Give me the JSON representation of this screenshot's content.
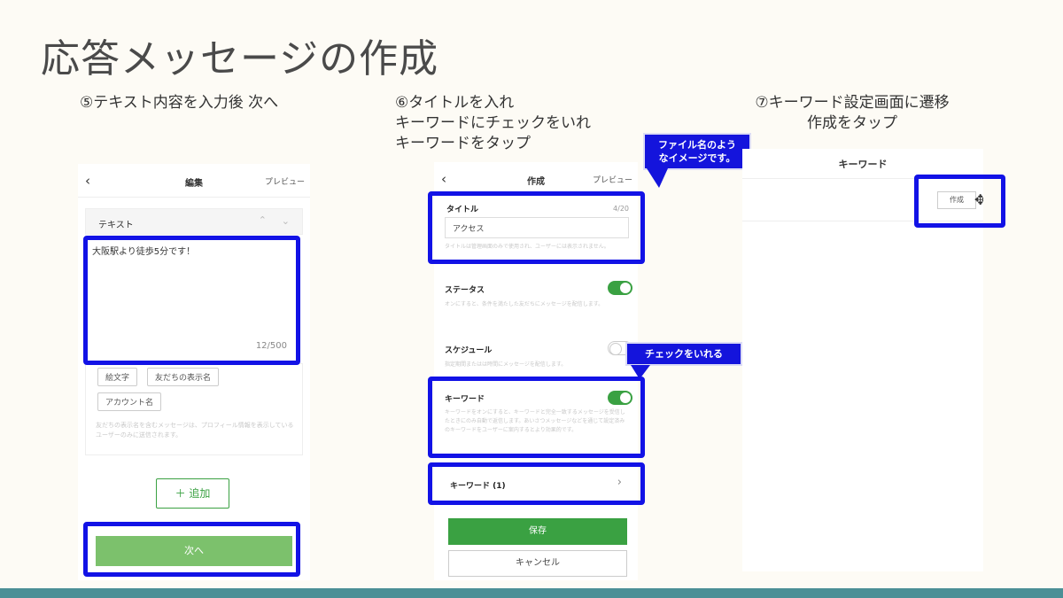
{
  "slide_title": "応答メッセージの作成",
  "steps": [
    {
      "caption_lines": [
        "⑤テキスト内容を入力後 次へ"
      ]
    },
    {
      "caption_lines": [
        "⑥タイトルを入れ",
        "キーワードにチェックをいれ",
        "キーワードをタップ"
      ]
    },
    {
      "caption_lines": [
        "⑦キーワード設定画面に遷移",
        "作成をタップ"
      ]
    }
  ],
  "screen1": {
    "back_icon": "chevron-left-icon",
    "title": "編集",
    "preview": "プレビュー",
    "section_label": "テキスト",
    "message_text": "大阪駅より徒歩5分です！",
    "char_count": "12/500",
    "chips": [
      "絵文字",
      "友だちの表示名",
      "アカウント名"
    ],
    "note": "友だちの表示名を含むメッセージは、プロフィール情報を表示しているユーザーのみに送信されます。",
    "add_label": "＋ 追加",
    "next_label": "次へ"
  },
  "screen2": {
    "back_icon": "chevron-left-icon",
    "title": "作成",
    "preview": "プレビュー",
    "title_label": "タイトル",
    "title_count": "4/20",
    "title_value": "アクセス",
    "title_hint": "タイトルは管理画面のみで使用され、ユーザーには表示されません。",
    "status_label": "ステータス",
    "status_on": true,
    "status_desc": "オンにすると、条件を満たした友だちにメッセージを配信します。",
    "schedule_label": "スケジュール",
    "schedule_on": false,
    "schedule_desc": "指定期間またはは時間にメッセージを配信します。",
    "keyword_label": "キーワード",
    "keyword_on": true,
    "keyword_desc": "キーワードをオンにすると、キーワードと完全一致するメッセージを受信したときにのみ自動で返信します。あいさつメッセージなどを通じて設定済みのキーワードをユーザーに案内するとより効果的です。",
    "keyword_row": "キーワード (1)",
    "save_label": "保存",
    "cancel_label": "キャンセル",
    "callout_file": "ファイル名のよう\nなイメージです。",
    "callout_check": "チェックをいれる"
  },
  "screen3": {
    "title": "キーワード",
    "create_label": "作成",
    "cursor_icon": "move-cursor-icon"
  },
  "colors": {
    "highlight_blue": "#1212e6",
    "line_green": "#3aa142",
    "next_green": "#7cc16c",
    "bottom_bar": "#4b8f96"
  }
}
